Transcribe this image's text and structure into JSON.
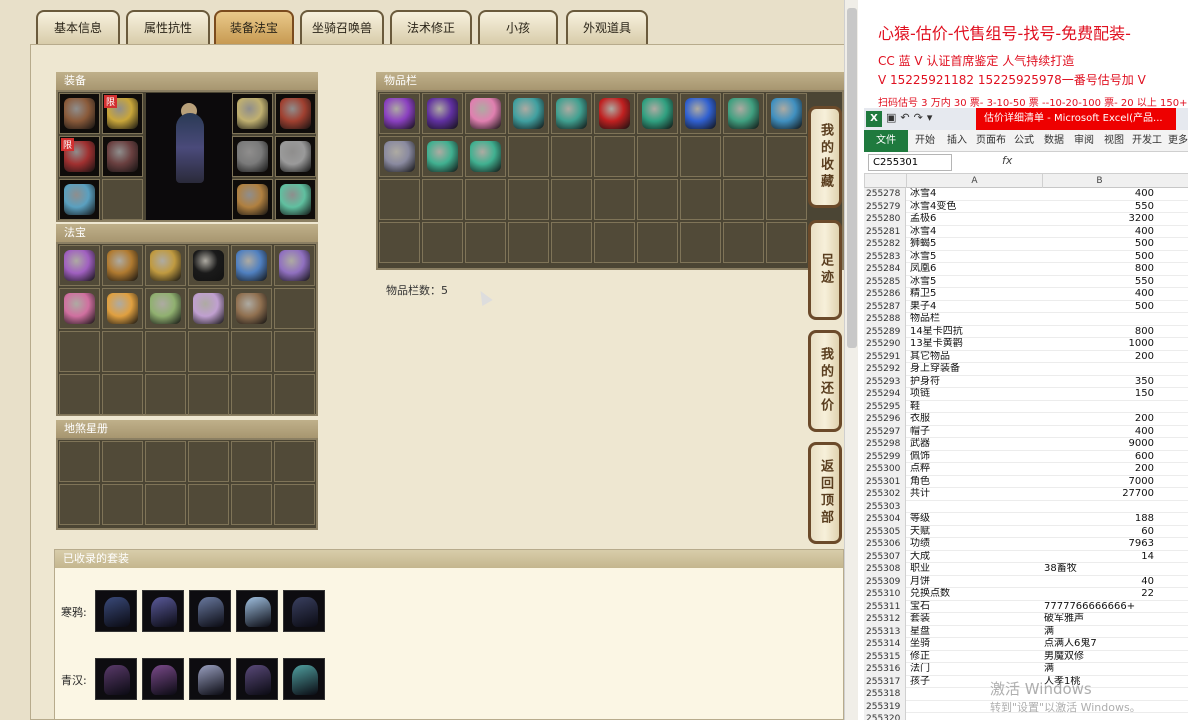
{
  "tabs": [
    "基本信息",
    "属性抗性",
    "装备法宝",
    "坐骑召唤兽",
    "法术修正",
    "小孩",
    "外观道具"
  ],
  "active_tab": "装备法宝",
  "panels": {
    "equip_title": "装备",
    "fabao_title": "法宝",
    "inventory_title": "物品栏",
    "star_album_title": "地煞星册",
    "sets_title": "已收录的套装"
  },
  "badges": {
    "limited": "限"
  },
  "item_count_label": "物品栏数：5",
  "side_buttons": [
    "我的收藏",
    "足迹",
    "我的还价",
    "返回顶部"
  ],
  "sets": [
    {
      "label": "寒鸦:"
    },
    {
      "label": "青汉:"
    }
  ],
  "excel": {
    "promo_line1": "心猿-估价-代售组号-找号-免费配装-",
    "promo_line2": "CC 蓝 V 认证首席鉴定  人气持续打造",
    "promo_line3": "V 15225921182        15225925978一番号估号加 V",
    "promo_line4": "扫码估号 3 万内 30 票- 3-10-50 票  --10-20-100 票- 20 以上 150+",
    "logo": "X",
    "window_title": "估价详细清单 - Microsoft Excel(产品...",
    "ribbon_tabs": [
      "文件",
      "开始",
      "插入",
      "页面布",
      "公式",
      "数据",
      "审阅",
      "视图",
      "开发工",
      "更多"
    ],
    "name_box": "C255301",
    "fx": "fx",
    "col_headers": [
      "A",
      "B"
    ],
    "rows": [
      {
        "n": "255278",
        "a": "冰雪4",
        "b": "400",
        "num": true
      },
      {
        "n": "255279",
        "a": "冰雪4变色",
        "b": "550",
        "num": true
      },
      {
        "n": "255280",
        "a": "孟极6",
        "b": "3200",
        "num": true
      },
      {
        "n": "255281",
        "a": "冰雪4",
        "b": "400",
        "num": true
      },
      {
        "n": "255282",
        "a": "狮蝎5",
        "b": "500",
        "num": true
      },
      {
        "n": "255283",
        "a": "冰雪5",
        "b": "500",
        "num": true
      },
      {
        "n": "255284",
        "a": "凤凰6",
        "b": "800",
        "num": true
      },
      {
        "n": "255285",
        "a": "冰雪5",
        "b": "550",
        "num": true
      },
      {
        "n": "255286",
        "a": "精卫5",
        "b": "400",
        "num": true
      },
      {
        "n": "255287",
        "a": "果子4",
        "b": "500",
        "num": true
      },
      {
        "n": "255288",
        "a": "物品栏",
        "b": "",
        "num": true
      },
      {
        "n": "255289",
        "a": "14星卡四抗",
        "b": "800",
        "num": true
      },
      {
        "n": "255290",
        "a": "13星卡黄鹳",
        "b": "1000",
        "num": true
      },
      {
        "n": "255291",
        "a": "其它物品",
        "b": "200",
        "num": true
      },
      {
        "n": "255292",
        "a": "身上穿装备",
        "b": "",
        "num": true
      },
      {
        "n": "255293",
        "a": "护身符",
        "b": "350",
        "num": true
      },
      {
        "n": "255294",
        "a": "项链",
        "b": "150",
        "num": true
      },
      {
        "n": "255295",
        "a": "鞋",
        "b": "",
        "num": true
      },
      {
        "n": "255296",
        "a": "衣服",
        "b": "200",
        "num": true
      },
      {
        "n": "255297",
        "a": "帽子",
        "b": "400",
        "num": true
      },
      {
        "n": "255298",
        "a": "武器",
        "b": "9000",
        "num": true
      },
      {
        "n": "255299",
        "a": "佩饰",
        "b": "600",
        "num": true
      },
      {
        "n": "255300",
        "a": "点粹",
        "b": "200",
        "num": true
      },
      {
        "n": "255301",
        "a": "角色",
        "b": "7000",
        "num": true
      },
      {
        "n": "255302",
        "a": "共计",
        "b": "27700",
        "num": true
      },
      {
        "n": "255303",
        "a": "",
        "b": "",
        "num": true
      },
      {
        "n": "255304",
        "a": "等级",
        "b": "188",
        "num": true
      },
      {
        "n": "255305",
        "a": "天赋",
        "b": "60",
        "num": true
      },
      {
        "n": "255306",
        "a": "功绩",
        "b": "7963",
        "num": true
      },
      {
        "n": "255307",
        "a": "大成",
        "b": "14",
        "num": true
      },
      {
        "n": "255308",
        "a": "职业",
        "b": "38畜牧",
        "num": false
      },
      {
        "n": "255309",
        "a": "月饼",
        "b": "40",
        "num": true
      },
      {
        "n": "255310",
        "a": "兑换点数",
        "b": "22",
        "num": true
      },
      {
        "n": "255311",
        "a": "宝石",
        "b": "7777766666666+",
        "num": false
      },
      {
        "n": "255312",
        "a": "套装",
        "b": "破军雅声",
        "num": false
      },
      {
        "n": "255313",
        "a": "星盘",
        "b": "满",
        "num": false
      },
      {
        "n": "255314",
        "a": "坐骑",
        "b": "点满人6鬼7",
        "num": false
      },
      {
        "n": "255315",
        "a": "修正",
        "b": "男魔双修",
        "num": false
      },
      {
        "n": "255316",
        "a": "法门",
        "b": "满",
        "num": false
      },
      {
        "n": "255317",
        "a": "孩子",
        "b": "人孝1桃",
        "num": false
      },
      {
        "n": "255318",
        "a": "",
        "b": "",
        "num": true
      },
      {
        "n": "255319",
        "a": "",
        "b": "",
        "num": true
      },
      {
        "n": "255320",
        "a": "",
        "b": "",
        "num": true
      }
    ]
  },
  "watermark": {
    "line1": "激活 Windows",
    "line2": "转到\"设置\"以激活 Windows。"
  },
  "colors": {
    "accent_red": "#e01020",
    "excel_green": "#1f7a3e",
    "tab_active": "#c79a52",
    "panel_title": "#a79670"
  },
  "item_colors": {
    "equip": [
      "#8a5a3a",
      "#c9a63a",
      "#a03030",
      "#6a4040",
      "#5aa0c0",
      "#c0b070",
      "#a04030",
      "#7a7a7a",
      "#9a9a9a",
      "#b08040",
      "#60c0a0"
    ],
    "fabao": [
      "#a060c0",
      "#b07a30",
      "#c09a40",
      "#1a1a1a",
      "#5080c0",
      "#9070c0",
      "#d070a0",
      "#e0a040",
      "#90b070",
      "#c0a0d0",
      "#907050"
    ],
    "inventory": [
      "#8a40c0",
      "#6030a0",
      "#e080b0",
      "#40a0a0",
      "#40a090",
      "#c02020",
      "#30a080",
      "#3060d0",
      "#40a080",
      "#4090c0",
      "#8a8aa0",
      "#40b090",
      "#40b090"
    ],
    "sets": [
      [
        "#3a4a7a",
        "#5a5a9a",
        "#6a7aa0",
        "#a0c0e0",
        "#3a4060"
      ],
      [
        "#5a3a6a",
        "#7a4a8a",
        "#9aa0c0",
        "#5a4a7a",
        "#50a0a0"
      ]
    ]
  }
}
